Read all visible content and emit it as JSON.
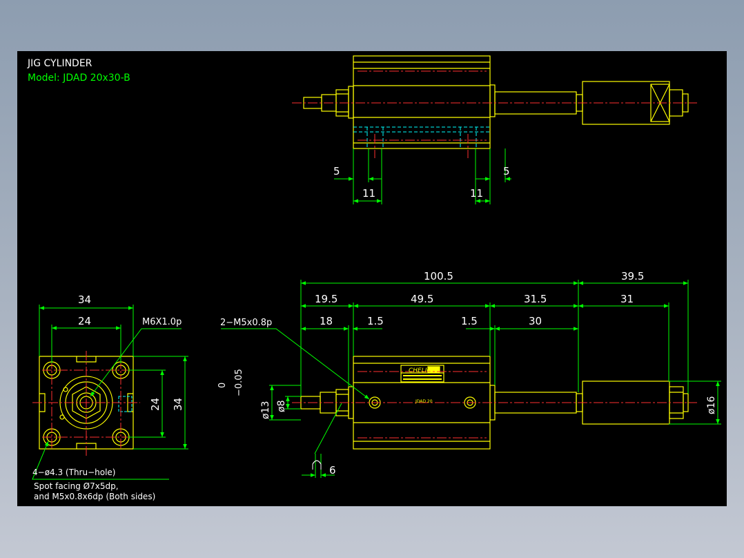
{
  "title": {
    "name": "JIG CYLINDER",
    "model": "Model:  JDAD 20x30-B"
  },
  "colors": {
    "background": "#000000",
    "outline": "#ffff00",
    "dimension": "#00ff00",
    "center_line": "#ff3030",
    "hidden_line": "#00ffff",
    "text": "#ffffff",
    "frame_gradient_top": "#8d9db0"
  },
  "top_view": {
    "dims": {
      "left_5": "5",
      "right_5": "5",
      "left_11": "11",
      "right_11": "11"
    }
  },
  "side_view": {
    "dims": {
      "d100_5": "100.5",
      "d39_5": "39.5",
      "d19_5": "19.5",
      "d49_5": "49.5",
      "d31_5": "31.5",
      "d31": "31",
      "d18": "18",
      "d1_5_left": "1.5",
      "d1_5_right": "1.5",
      "d30": "30",
      "d6": "6",
      "phi8": "ø8",
      "phi13": "ø13",
      "tol_upper": "0",
      "tol_lower": "−0.05",
      "phi16": "ø16"
    },
    "port_note": "2−M5x0.8p",
    "brand": "CHELIC",
    "model_label": "JDAD 20"
  },
  "front_view": {
    "dims": {
      "d34_top": "34",
      "d24_top": "24",
      "d24_side": "24",
      "d34_side": "34"
    },
    "thread_note": "M6X1.0p",
    "hole_note_1": "4−ø4.3 (Thru−hole)",
    "hole_note_2": "Spot facing  Ø7x5dp,",
    "hole_note_3": "and M5x0.8x6dp (Both sides)"
  }
}
